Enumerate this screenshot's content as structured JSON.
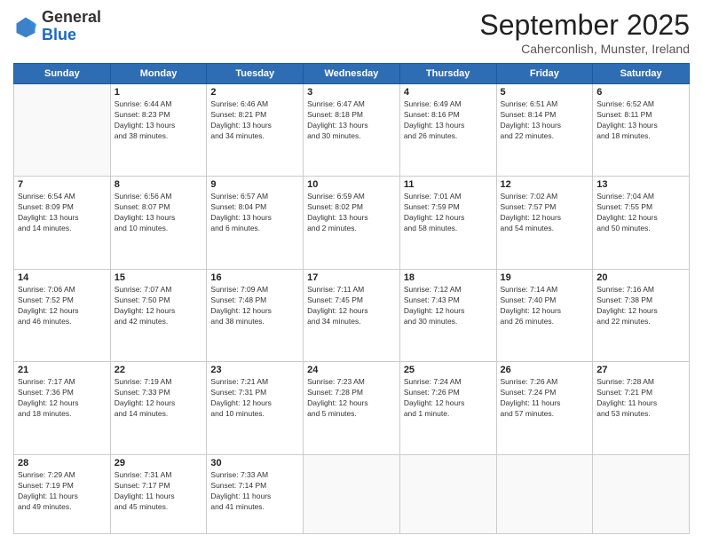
{
  "header": {
    "logo_general": "General",
    "logo_blue": "Blue",
    "month_title": "September 2025",
    "subtitle": "Caherconlish, Munster, Ireland"
  },
  "days_of_week": [
    "Sunday",
    "Monday",
    "Tuesday",
    "Wednesday",
    "Thursday",
    "Friday",
    "Saturday"
  ],
  "weeks": [
    [
      {
        "day": "",
        "content": ""
      },
      {
        "day": "1",
        "content": "Sunrise: 6:44 AM\nSunset: 8:23 PM\nDaylight: 13 hours\nand 38 minutes."
      },
      {
        "day": "2",
        "content": "Sunrise: 6:46 AM\nSunset: 8:21 PM\nDaylight: 13 hours\nand 34 minutes."
      },
      {
        "day": "3",
        "content": "Sunrise: 6:47 AM\nSunset: 8:18 PM\nDaylight: 13 hours\nand 30 minutes."
      },
      {
        "day": "4",
        "content": "Sunrise: 6:49 AM\nSunset: 8:16 PM\nDaylight: 13 hours\nand 26 minutes."
      },
      {
        "day": "5",
        "content": "Sunrise: 6:51 AM\nSunset: 8:14 PM\nDaylight: 13 hours\nand 22 minutes."
      },
      {
        "day": "6",
        "content": "Sunrise: 6:52 AM\nSunset: 8:11 PM\nDaylight: 13 hours\nand 18 minutes."
      }
    ],
    [
      {
        "day": "7",
        "content": "Sunrise: 6:54 AM\nSunset: 8:09 PM\nDaylight: 13 hours\nand 14 minutes."
      },
      {
        "day": "8",
        "content": "Sunrise: 6:56 AM\nSunset: 8:07 PM\nDaylight: 13 hours\nand 10 minutes."
      },
      {
        "day": "9",
        "content": "Sunrise: 6:57 AM\nSunset: 8:04 PM\nDaylight: 13 hours\nand 6 minutes."
      },
      {
        "day": "10",
        "content": "Sunrise: 6:59 AM\nSunset: 8:02 PM\nDaylight: 13 hours\nand 2 minutes."
      },
      {
        "day": "11",
        "content": "Sunrise: 7:01 AM\nSunset: 7:59 PM\nDaylight: 12 hours\nand 58 minutes."
      },
      {
        "day": "12",
        "content": "Sunrise: 7:02 AM\nSunset: 7:57 PM\nDaylight: 12 hours\nand 54 minutes."
      },
      {
        "day": "13",
        "content": "Sunrise: 7:04 AM\nSunset: 7:55 PM\nDaylight: 12 hours\nand 50 minutes."
      }
    ],
    [
      {
        "day": "14",
        "content": "Sunrise: 7:06 AM\nSunset: 7:52 PM\nDaylight: 12 hours\nand 46 minutes."
      },
      {
        "day": "15",
        "content": "Sunrise: 7:07 AM\nSunset: 7:50 PM\nDaylight: 12 hours\nand 42 minutes."
      },
      {
        "day": "16",
        "content": "Sunrise: 7:09 AM\nSunset: 7:48 PM\nDaylight: 12 hours\nand 38 minutes."
      },
      {
        "day": "17",
        "content": "Sunrise: 7:11 AM\nSunset: 7:45 PM\nDaylight: 12 hours\nand 34 minutes."
      },
      {
        "day": "18",
        "content": "Sunrise: 7:12 AM\nSunset: 7:43 PM\nDaylight: 12 hours\nand 30 minutes."
      },
      {
        "day": "19",
        "content": "Sunrise: 7:14 AM\nSunset: 7:40 PM\nDaylight: 12 hours\nand 26 minutes."
      },
      {
        "day": "20",
        "content": "Sunrise: 7:16 AM\nSunset: 7:38 PM\nDaylight: 12 hours\nand 22 minutes."
      }
    ],
    [
      {
        "day": "21",
        "content": "Sunrise: 7:17 AM\nSunset: 7:36 PM\nDaylight: 12 hours\nand 18 minutes."
      },
      {
        "day": "22",
        "content": "Sunrise: 7:19 AM\nSunset: 7:33 PM\nDaylight: 12 hours\nand 14 minutes."
      },
      {
        "day": "23",
        "content": "Sunrise: 7:21 AM\nSunset: 7:31 PM\nDaylight: 12 hours\nand 10 minutes."
      },
      {
        "day": "24",
        "content": "Sunrise: 7:23 AM\nSunset: 7:28 PM\nDaylight: 12 hours\nand 5 minutes."
      },
      {
        "day": "25",
        "content": "Sunrise: 7:24 AM\nSunset: 7:26 PM\nDaylight: 12 hours\nand 1 minute."
      },
      {
        "day": "26",
        "content": "Sunrise: 7:26 AM\nSunset: 7:24 PM\nDaylight: 11 hours\nand 57 minutes."
      },
      {
        "day": "27",
        "content": "Sunrise: 7:28 AM\nSunset: 7:21 PM\nDaylight: 11 hours\nand 53 minutes."
      }
    ],
    [
      {
        "day": "28",
        "content": "Sunrise: 7:29 AM\nSunset: 7:19 PM\nDaylight: 11 hours\nand 49 minutes."
      },
      {
        "day": "29",
        "content": "Sunrise: 7:31 AM\nSunset: 7:17 PM\nDaylight: 11 hours\nand 45 minutes."
      },
      {
        "day": "30",
        "content": "Sunrise: 7:33 AM\nSunset: 7:14 PM\nDaylight: 11 hours\nand 41 minutes."
      },
      {
        "day": "",
        "content": ""
      },
      {
        "day": "",
        "content": ""
      },
      {
        "day": "",
        "content": ""
      },
      {
        "day": "",
        "content": ""
      }
    ]
  ]
}
